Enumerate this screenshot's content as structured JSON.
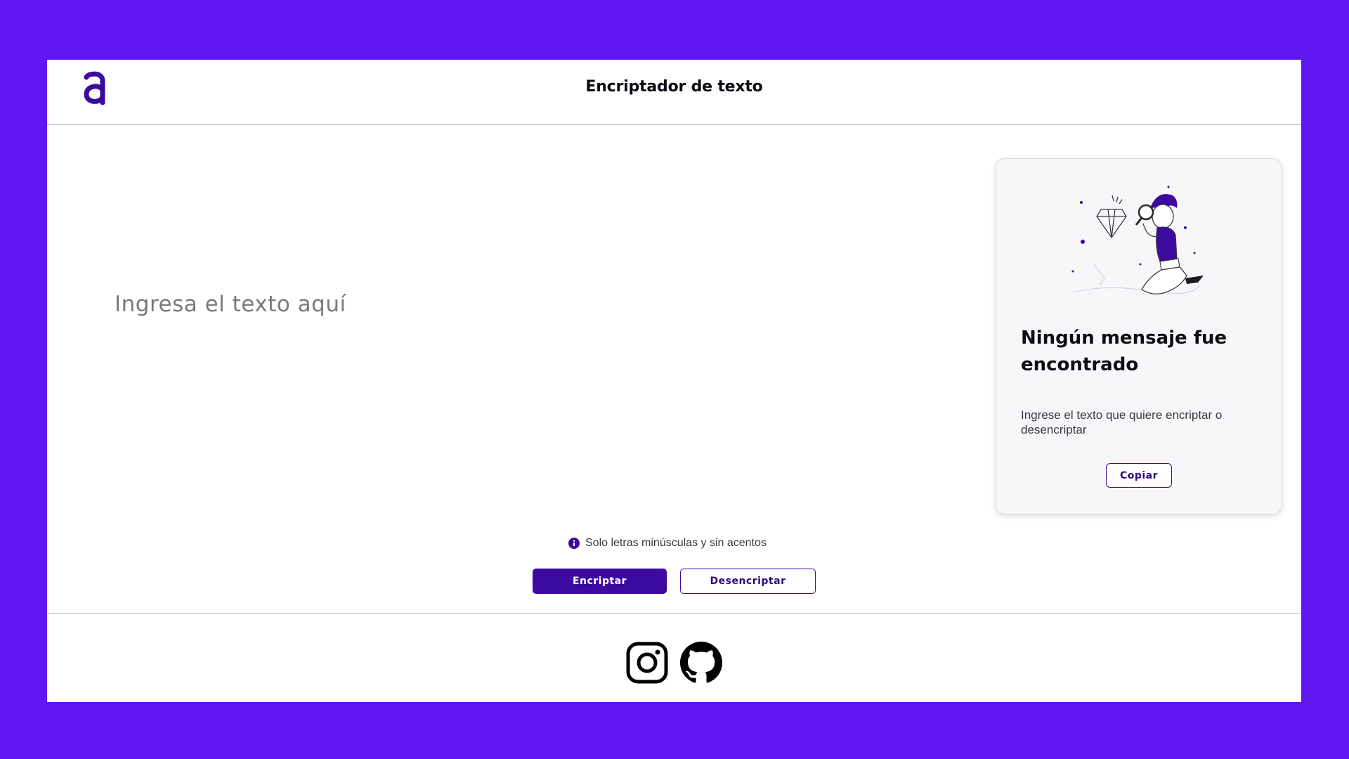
{
  "header": {
    "title": "Encriptador de texto"
  },
  "input": {
    "placeholder": "Ingresa el texto aquí"
  },
  "hint": {
    "text": "Solo letras minúsculas y sin acentos"
  },
  "actions": {
    "encrypt_label": "Encriptar",
    "decrypt_label": "Desencriptar"
  },
  "output": {
    "title": "Ningún mensaje fue encontrado",
    "description": "Ingrese el texto que quiere encriptar o desencriptar",
    "copy_label": "Copiar"
  },
  "footer": {
    "links": [
      {
        "icon": "instagram-icon"
      },
      {
        "icon": "github-icon"
      }
    ]
  },
  "colors": {
    "background": "#6016f0",
    "accent": "#3d0aa0",
    "surface": "#ffffff",
    "card": "#f7f6f9"
  }
}
